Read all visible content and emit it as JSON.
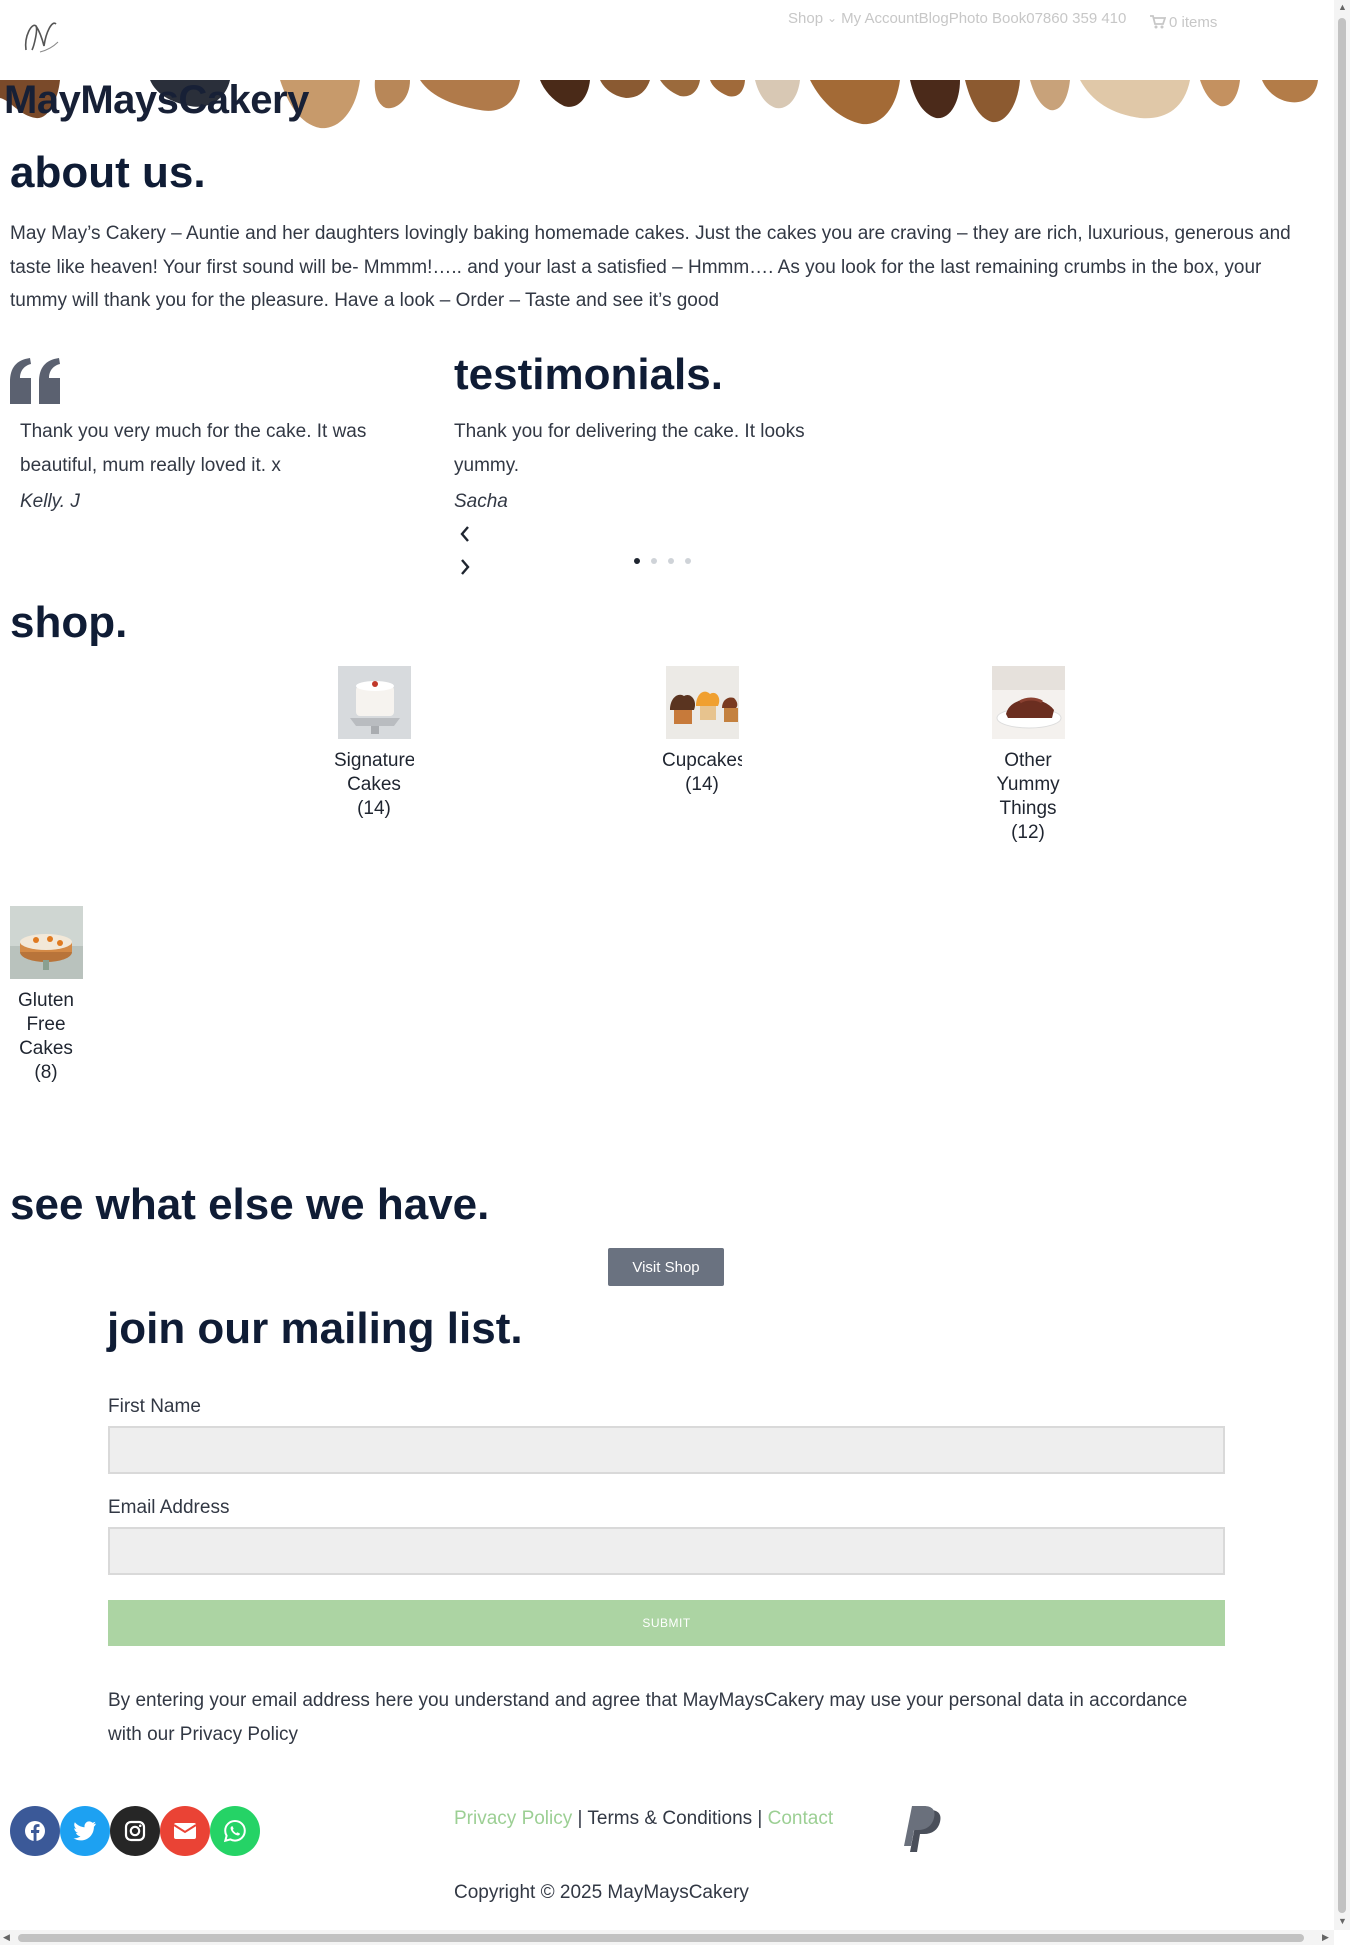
{
  "header": {
    "nav": {
      "shop": "Shop",
      "my_account": "My Account",
      "blog": "Blog",
      "photo_book": "Photo Book",
      "phone": "07860 359 410",
      "cart": "0 items"
    }
  },
  "site_title": "MayMaysCakery",
  "about": {
    "heading": "about us.",
    "text": "May May’s Cakery – Auntie and her daughters lovingly baking homemade cakes. Just the cakes you are craving – they are rich, luxurious, generous and taste like heaven! Your first sound will be- Mmmm!….. and your last a satisfied – Hmmm…. As you look for the last remaining crumbs in the box, your tummy will thank you for the pleasure. Have a look – Order – Taste and see it’s good"
  },
  "testimonials": {
    "heading": "testimonials.",
    "items": [
      {
        "text": "Thank you very much for the cake. It was beautiful, mum really loved it. x",
        "author": "Kelly. J"
      },
      {
        "text": "Thank you for delivering the cake. It looks yummy.",
        "author": "Sacha"
      }
    ],
    "slide_count": 4,
    "active_slide": 1
  },
  "shop": {
    "heading": "shop.",
    "categories": [
      {
        "name": "Signature Cakes",
        "count": "(14)"
      },
      {
        "name": "Cupcakes",
        "count": "(14)"
      },
      {
        "name": "Other Yummy Things",
        "count": "(12)"
      },
      {
        "name": "Gluten Free Cakes",
        "count": "(8)"
      }
    ]
  },
  "see_what": {
    "heading": "see what else we have.",
    "button": "Visit Shop"
  },
  "mailing": {
    "heading": "join our mailing list.",
    "first_name_label": "First Name",
    "first_name_value": "",
    "email_label": "Email Address",
    "email_value": "",
    "submit": "SUBMIT",
    "consent": "By entering your email address here you understand and agree that MayMaysCakery may use your personal data in accordance with our Privacy Policy"
  },
  "footer": {
    "privacy": "Privacy Policy",
    "separator": "|",
    "terms": "Terms & Conditions",
    "contact": "Contact",
    "copyright": "Copyright © 2025 MayMaysCakery"
  },
  "colors": {
    "heading": "#0f1c35",
    "link_green": "#9ccf94",
    "submit_green": "#acd4a3",
    "button_gray": "#6a7280",
    "facebook": "#3b5998",
    "twitter": "#1da1f2",
    "instagram": "#262626",
    "email": "#ea4335",
    "whatsapp": "#25d366"
  },
  "icons": [
    "logo-icon",
    "chevron-down-icon",
    "cart-icon",
    "quote-icon",
    "chevron-left-icon",
    "chevron-right-icon",
    "facebook-icon",
    "twitter-icon",
    "instagram-icon",
    "envelope-icon",
    "whatsapp-icon",
    "paypal-icon"
  ]
}
